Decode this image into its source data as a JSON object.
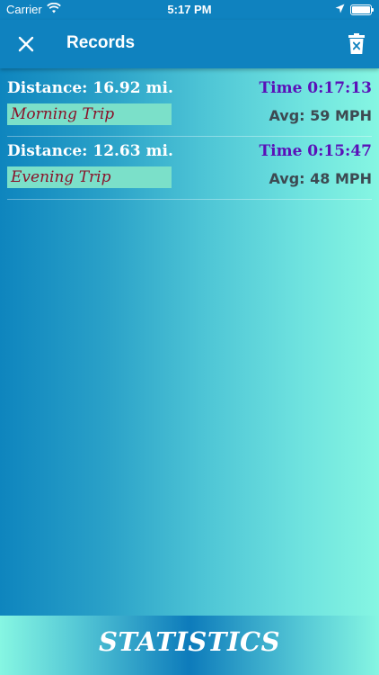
{
  "status_bar": {
    "carrier": "Carrier",
    "time": "5:17 PM",
    "icons": [
      "wifi-icon",
      "location-arrow-icon",
      "battery-icon"
    ]
  },
  "nav": {
    "title": "Records",
    "left_icon": "close-icon",
    "right_icon": "trash-icon"
  },
  "records": [
    {
      "distance": "Distance: 16.92 mi.",
      "time": "Time 0:17:13",
      "name": "Morning Trip",
      "avg": "Avg: 59 MPH"
    },
    {
      "distance": "Distance: 12.63 mi.",
      "time": "Time 0:15:47",
      "name": "Evening Trip",
      "avg": "Avg: 48 MPH"
    }
  ],
  "statistics_button": {
    "label": "STATISTICS"
  },
  "colors": {
    "bar": "#0f82bf",
    "time_text": "#5a10b8",
    "trip_name_text": "#8a1229",
    "trip_name_bg": "#7be0c9",
    "avg_text": "#3d4a52"
  }
}
